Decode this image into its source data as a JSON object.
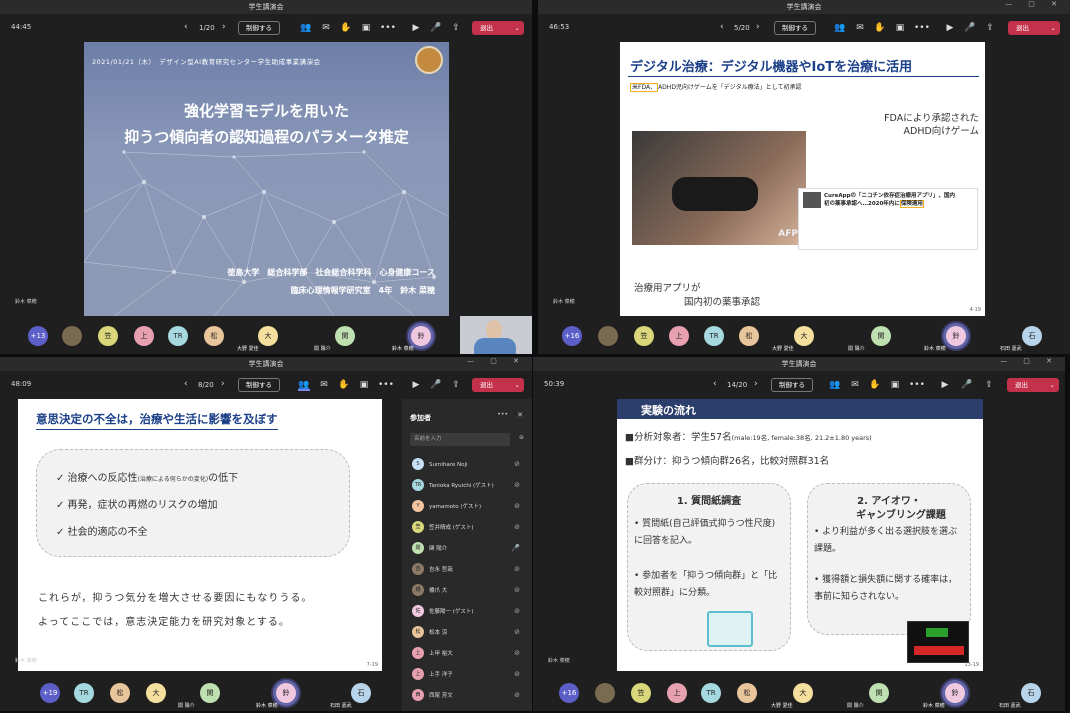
{
  "window_title": "学生講演会",
  "controls": {
    "hangup": "退出",
    "share_ctrl": "制御する",
    "chevron": "⌄",
    "prev": "‹",
    "next": "›",
    "more": "•••",
    "win": "— ▢ ✕"
  },
  "q1": {
    "timer": "44:45",
    "page": "1/20",
    "slide": {
      "meta": "2021/01/21（木）　デザイン型AI教育研究センター学生助成事業講演会",
      "title1": "強化学習モデルを用いた",
      "title2": "抑うつ傾向者の認知過程のパラメータ推定",
      "author1": "徳島大学　総合科学部　社会総合科学科　心身健康コース",
      "author2": "臨床心理情報学研究室　4年　鈴木 菜穂"
    },
    "speaker": "鈴木 菜穂",
    "count": "+13",
    "avatars": [
      "笠",
      "上",
      "TR",
      "松",
      "大",
      "関",
      "鈴"
    ],
    "labels": [
      "大野 愛佳",
      "関 陽介",
      "鈴木 菜穂"
    ]
  },
  "q2": {
    "timer": "46:53",
    "page": "5/20",
    "slide": {
      "title": "デジタル治療：デジタル機器やIoTを治療に活用",
      "article_hl": "米FDA、",
      "article_title": "ADHD児向けゲームを「デジタル療法」として初承認",
      "img_label": "AFP",
      "caption1a": "FDAにより承認された",
      "caption1b": "ADHD向けゲーム",
      "news2_a": "CureAppの「ニコチン依存症治療用アプリ」、国内",
      "news2_b": "初の薬事承認へ…2020年内に",
      "news2_hl": "保険適用",
      "caption2a": "治療用アプリが",
      "caption2b": "国内初の薬事承認",
      "pgnum": "4-19"
    },
    "speaker": "鈴木 菜穂",
    "count": "+16",
    "avatars": [
      "笠",
      "上",
      "TR",
      "松",
      "大",
      "関",
      "鈴",
      "石"
    ],
    "labels": [
      "大野 愛佳",
      "関 陽介",
      "鈴木 菜穂",
      "石田 嘉武"
    ]
  },
  "q3": {
    "timer": "48:09",
    "page": "8/20",
    "slide": {
      "title": "意思決定の不全は，治療や生活に影響を及ぼす",
      "b1": "✓ 治療への反応性",
      "b1s": "(治療による何らかの変化)",
      "b1e": "の低下",
      "b2": "✓ 再発，症状の再燃のリスクの増加",
      "b3": "✓ 社会的適応の不全",
      "p1": "これらが，抑うつ気分を増大させる要因にもなりうる。",
      "p2": "よってここでは，意志決定能力を研究対象とする。",
      "pgnum": "7-19"
    },
    "speaker": "鈴木 菜穂",
    "count": "+19",
    "avatars": [
      "TR",
      "松",
      "大",
      "関",
      "鈴",
      "石"
    ],
    "labels": [
      "関 陽介",
      "鈴木 菜穂",
      "石田 嘉武"
    ],
    "panel": {
      "title": "参加者",
      "search": "名前を入力",
      "people": [
        {
          "i": "S",
          "n": "Sumihare Noji"
        },
        {
          "i": "TR",
          "n": "Tanioka Ryuichi (ゲスト)"
        },
        {
          "i": "Y",
          "n": "yamamoto (ゲスト)"
        },
        {
          "i": "笠",
          "n": "笠井晴成 (ゲスト)"
        },
        {
          "i": "関",
          "n": "関 陽介"
        },
        {
          "i": "吉",
          "n": "吉永 哲哉"
        },
        {
          "i": "橋",
          "n": "橋爪 大"
        },
        {
          "i": "佐",
          "n": "佐藤陽一 (ゲスト)"
        },
        {
          "i": "松",
          "n": "松本 涼"
        },
        {
          "i": "上",
          "n": "上甲 裕大"
        },
        {
          "i": "上",
          "n": "上手 洋子"
        },
        {
          "i": "西",
          "n": "西尾 芳文"
        }
      ]
    }
  },
  "q4": {
    "timer": "50:39",
    "page": "14/20",
    "slide": {
      "title": "実験の流れ",
      "l1": "■分析対象者：学生57名",
      "l1s": "(male:19名, female:38名, 21.2±1.80 years)",
      "l2": "■群分け：抑うつ傾向群26名，比較対照群31名",
      "box1_title": "1. 質問紙調査",
      "box1_b1": "• 質問紙(自己評価式抑うつ性尺度)に回答を記入。",
      "box1_b2": "• 参加者を「抑うつ傾向群」と「比較対照群」に分類。",
      "box2_title1": "2. アイオワ・",
      "box2_title2": "ギャンブリング課題",
      "box2_b1": "• より利益が多く出る選択肢を選ぶ課題。",
      "box2_b2": "• 獲得額と損失額に関する確率は，事前に知らされない。",
      "pgnum": "13-19"
    },
    "speaker": "鈴木 菜穂",
    "count": "+16",
    "avatars": [
      "笠",
      "上",
      "TR",
      "松",
      "大",
      "関",
      "鈴",
      "石"
    ],
    "labels": [
      "大野 愛佳",
      "関 陽介",
      "鈴木 菜穂",
      "石田 嘉武"
    ]
  }
}
